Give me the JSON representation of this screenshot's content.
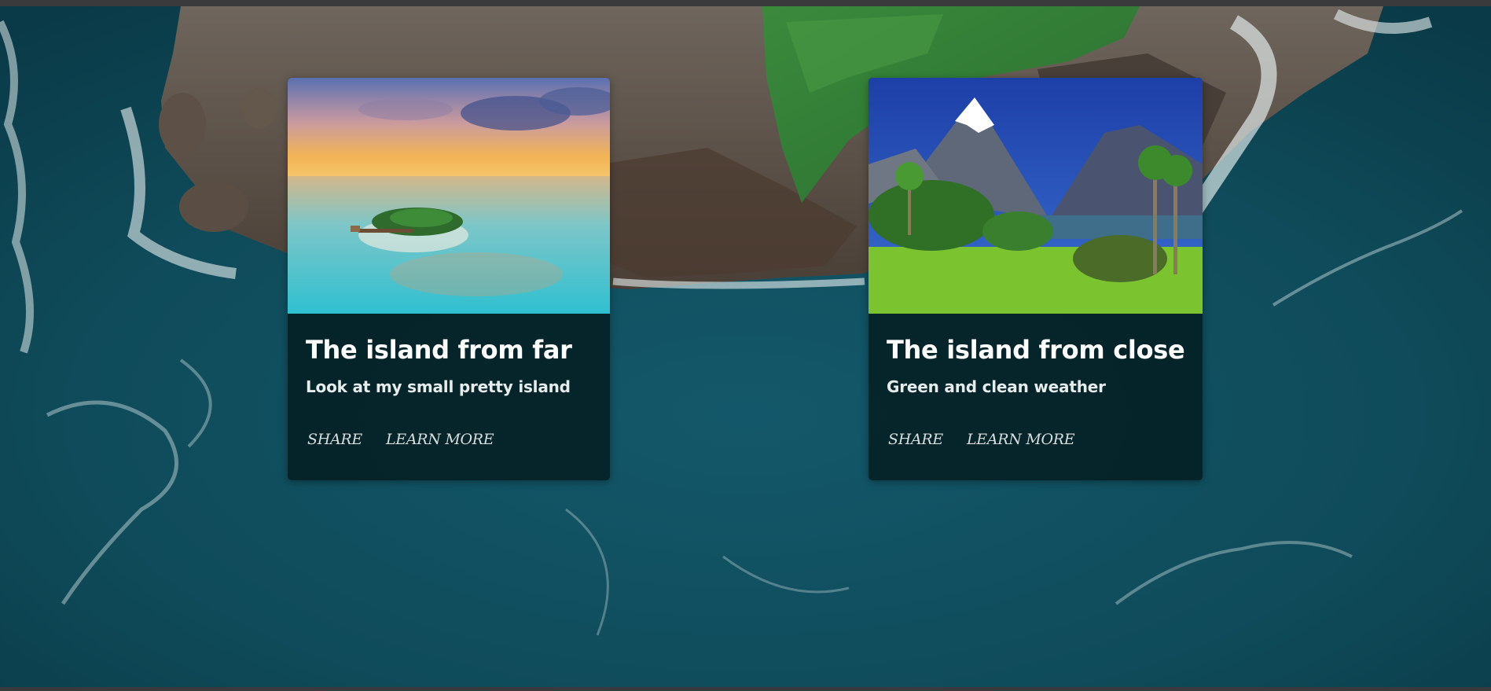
{
  "cards": [
    {
      "title": "The island from far",
      "subtitle": "Look at my small pretty island",
      "actions": {
        "share": "SHARE",
        "learn_more": "LEARN MORE"
      }
    },
    {
      "title": "The island from close",
      "subtitle": "Green and clean weather",
      "actions": {
        "share": "SHARE",
        "learn_more": "LEARN MORE"
      }
    }
  ],
  "colors": {
    "sea": "#0f4d5c",
    "card_overlay": "#02181b",
    "text": "#ffffff",
    "action_text": "#d6dddd"
  }
}
